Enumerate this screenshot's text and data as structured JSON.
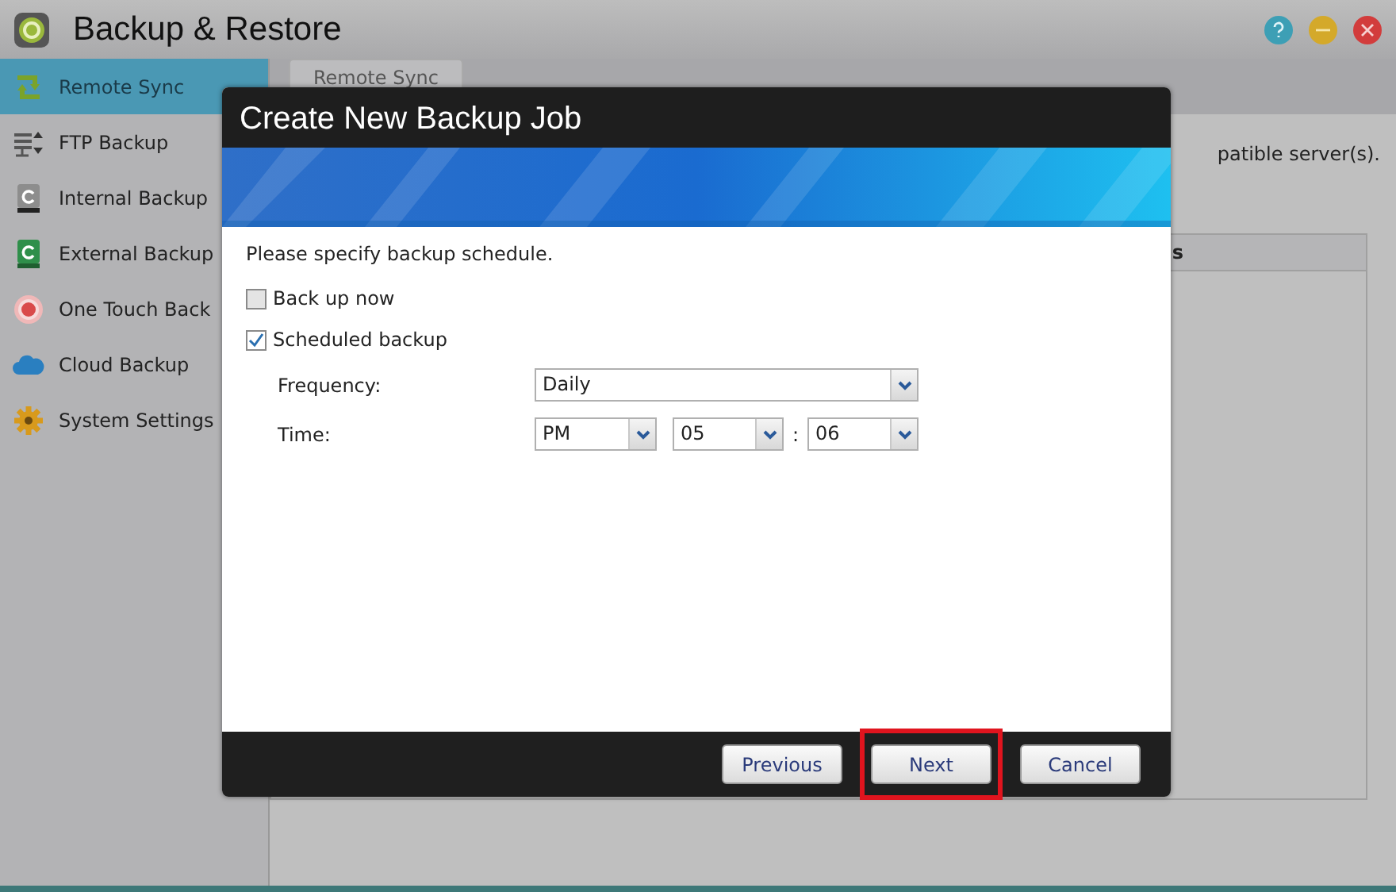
{
  "window": {
    "title": "Backup & Restore"
  },
  "sidebar": {
    "items": [
      {
        "label": "Remote Sync",
        "selected": true
      },
      {
        "label": "FTP Backup",
        "selected": false
      },
      {
        "label": "Internal Backup",
        "selected": false
      },
      {
        "label": "External Backup",
        "selected": false
      },
      {
        "label": "One Touch Back",
        "selected": false
      },
      {
        "label": "Cloud Backup",
        "selected": false
      },
      {
        "label": "System Settings",
        "selected": false
      }
    ]
  },
  "background": {
    "tab": "Remote Sync",
    "description": "patible server(s).",
    "table_header": "s"
  },
  "dialog": {
    "title": "Create New Backup Job",
    "instruction": "Please specify backup schedule.",
    "options": [
      {
        "label": "Back up now",
        "checked": false
      },
      {
        "label": "Scheduled backup",
        "checked": true
      }
    ],
    "frequency": {
      "label": "Frequency:",
      "value": "Daily"
    },
    "time": {
      "label": "Time:",
      "period": "PM",
      "hour": "05",
      "separator": ":",
      "minute": "06"
    },
    "buttons": [
      {
        "label": "Previous",
        "highlighted": false
      },
      {
        "label": "Next",
        "highlighted": true
      },
      {
        "label": "Cancel",
        "highlighted": false
      }
    ]
  }
}
